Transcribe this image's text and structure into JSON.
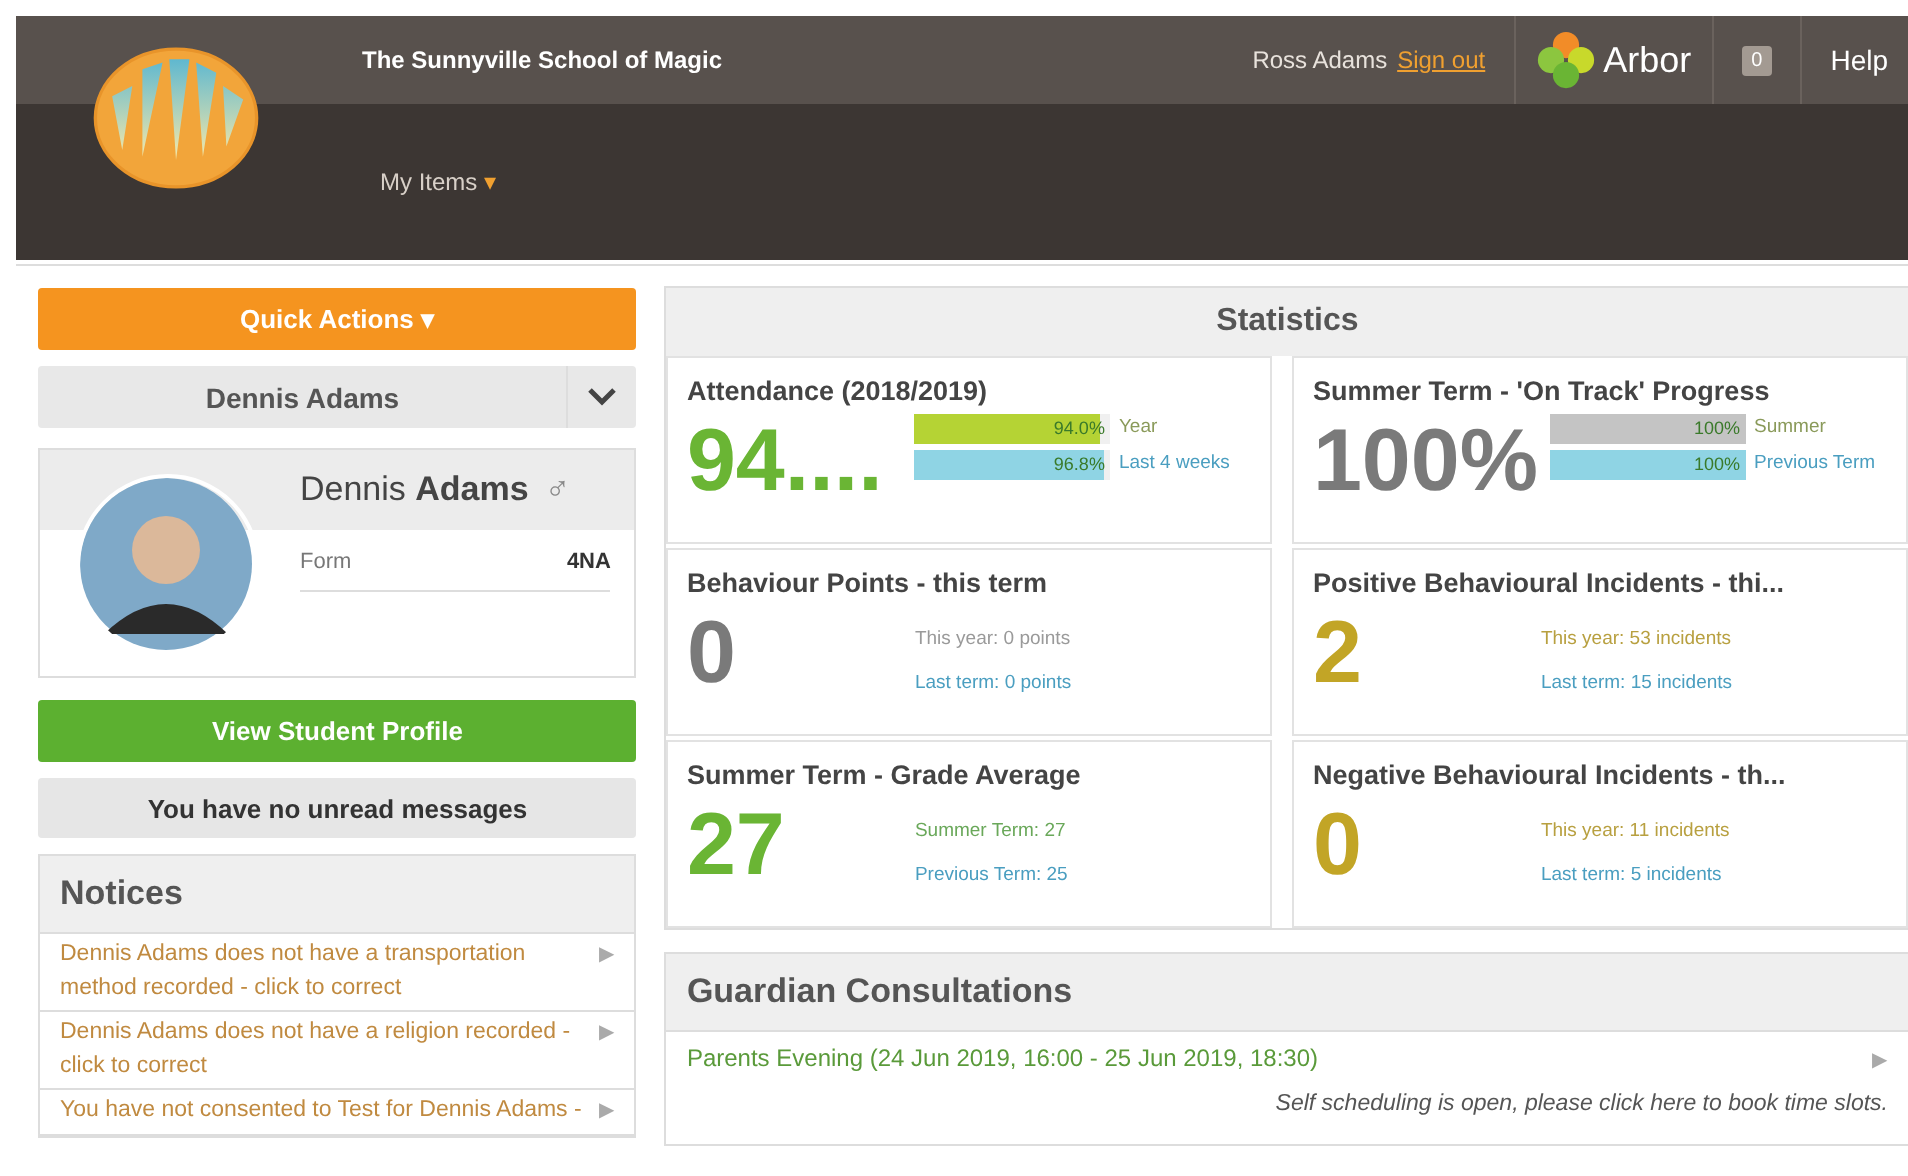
{
  "header": {
    "school_name": "The Sunnyville School of Magic",
    "user_name": "Ross Adams",
    "sign_out": "Sign out",
    "brand": "Arbor",
    "message_count": "0",
    "help": "Help",
    "menu": [
      {
        "label": "My Items",
        "caret": "▾"
      }
    ]
  },
  "sidebar": {
    "quick_actions": {
      "label": "Quick Actions",
      "caret": "▾"
    },
    "student_select": {
      "value": "Dennis Adams"
    },
    "student": {
      "first_name": "Dennis",
      "last_name": "Adams",
      "gender_symbol": "♂",
      "fields": [
        {
          "label": "Form",
          "value": "4NA"
        }
      ]
    },
    "profile_button": "View Student Profile",
    "messages": "You have no unread messages",
    "notices": {
      "title": "Notices",
      "items": [
        {
          "text": "Dennis Adams does not have a transportation method recorded - click to correct",
          "arrow": "▶"
        },
        {
          "text": "Dennis Adams does not have a religion recorded - click to correct",
          "arrow": "▶"
        },
        {
          "text": "You have not consented to Test for Dennis Adams -",
          "arrow": "▶"
        }
      ]
    }
  },
  "statistics": {
    "title": "Statistics",
    "cards": [
      {
        "kind": "bars",
        "title": "Attendance (2018/2019)",
        "value": "94....",
        "color": "#6ab534",
        "bars": [
          {
            "reading": "94.0%",
            "label": "Year",
            "level": 0.94,
            "color": "#b5d334"
          },
          {
            "reading": "96.8%",
            "label": "Last 4 weeks",
            "level": 0.968,
            "color": "#8fd4e4"
          }
        ]
      },
      {
        "kind": "bars",
        "title": "Summer Term - 'On Track' Progress",
        "value": "100%",
        "color": "#7a7a7a",
        "bars": [
          {
            "reading": "100%",
            "label": "Summer",
            "level": 1,
            "color": "#c4c4c4"
          },
          {
            "reading": "100%",
            "label": "Previous Term",
            "level": 1,
            "color": "#8fd4e4"
          }
        ]
      },
      {
        "kind": "lines",
        "title": "Behaviour Points - this term",
        "value": "0",
        "color": "#7a7a7a",
        "lines": [
          {
            "text": "This year: 0 points",
            "color": "#9a9a9a"
          },
          {
            "text": "Last term: 0 points",
            "color": "#4a9ec0"
          }
        ]
      },
      {
        "kind": "lines",
        "title": "Positive Behavioural Incidents - thi...",
        "value": "2",
        "color": "#c2a526",
        "lines": [
          {
            "text": "This year: 53 incidents",
            "color": "#b8a040"
          },
          {
            "text": "Last term: 15 incidents",
            "color": "#4a9ec0"
          }
        ]
      },
      {
        "kind": "lines",
        "title": "Summer Term - Grade Average",
        "value": "27",
        "color": "#6ab534",
        "lines": [
          {
            "text": "Summer Term: 27",
            "color": "#6aa85a"
          },
          {
            "text": "Previous Term: 25",
            "color": "#4a9ec0"
          }
        ]
      },
      {
        "kind": "lines",
        "title": "Negative Behavioural Incidents - th...",
        "value": "0",
        "color": "#c2a526",
        "lines": [
          {
            "text": "This year: 11 incidents",
            "color": "#b8a040"
          },
          {
            "text": "Last term: 5 incidents",
            "color": "#4a9ec0"
          }
        ]
      }
    ]
  },
  "consultations": {
    "title": "Guardian Consultations",
    "items": [
      {
        "title": "Parents Evening (24 Jun 2019, 16:00 - 25 Jun 2019, 18:30)",
        "note": "Self scheduling is open, please click here to book time slots.",
        "arrow": "▶"
      }
    ]
  }
}
